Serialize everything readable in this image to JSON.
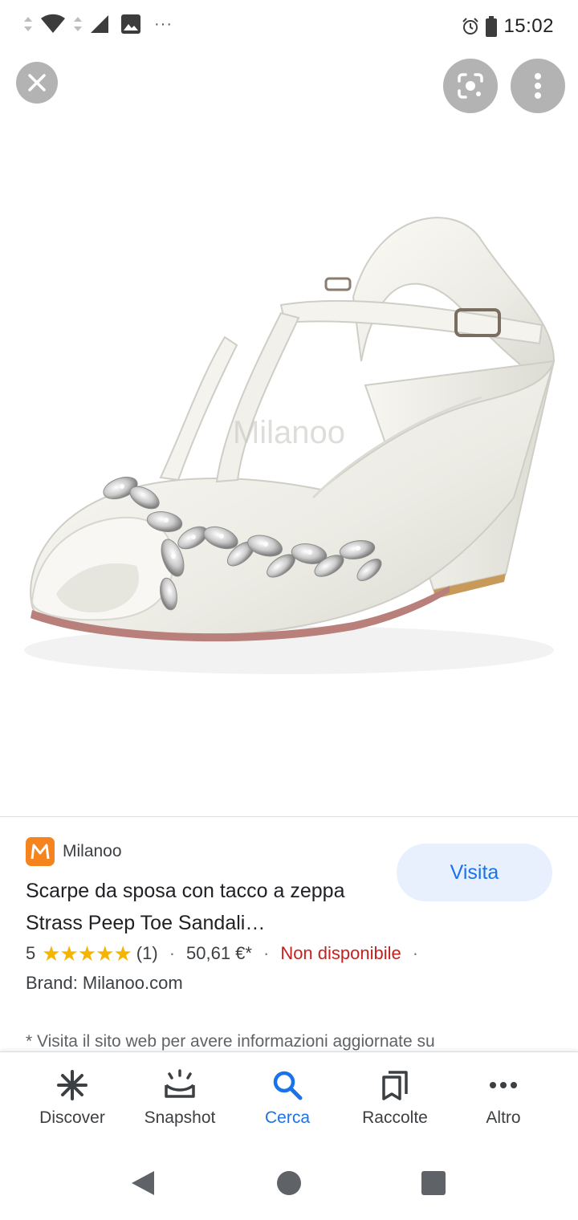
{
  "status_bar": {
    "time": "15:02",
    "more_notifications": "···",
    "icons": [
      "data-arrows-icon",
      "wifi-icon",
      "signal-icon",
      "image-icon",
      "alarm-icon",
      "battery-icon"
    ]
  },
  "controls": {
    "close_icon": "close-icon",
    "lens_icon": "lens-search-icon",
    "more_icon": "more-vert-icon"
  },
  "product_image": {
    "watermark": "Milanoo"
  },
  "result": {
    "source_logo_letter": "M",
    "source_name": "Milanoo",
    "visit_label": "Visita",
    "title": "Scarpe da sposa con tacco a zeppa Strass Peep Toe Sandali…",
    "rating": "5",
    "stars": "★★★★★",
    "reviews": "(1)",
    "separator": "·",
    "price": "50,61 €*",
    "availability": "Non disponibile",
    "brand": "Brand: Milanoo.com",
    "notice": "* Visita il sito web per avere informazioni aggiornate su"
  },
  "bottom_nav": [
    {
      "label": "Discover",
      "icon": "asterisk-icon",
      "active": false
    },
    {
      "label": "Snapshot",
      "icon": "snapshot-icon",
      "active": false
    },
    {
      "label": "Cerca",
      "icon": "search-icon",
      "active": true
    },
    {
      "label": "Raccolte",
      "icon": "collections-icon",
      "active": false
    },
    {
      "label": "Altro",
      "icon": "more-horiz-icon",
      "active": false
    }
  ],
  "colors": {
    "accent": "#1a73e8",
    "unavailable": "#c5221f",
    "star": "#f4b400",
    "source_logo": "#f5841f",
    "visit_bg": "#e8f0fe"
  }
}
